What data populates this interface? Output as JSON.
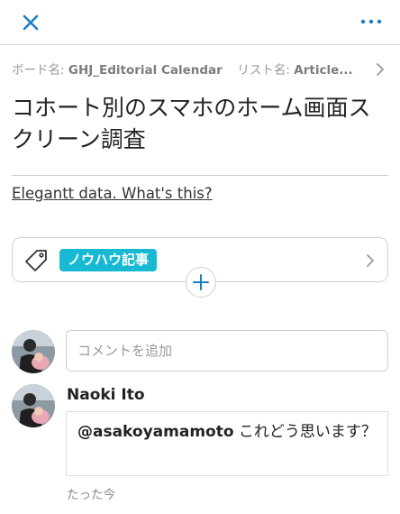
{
  "header": {
    "close_icon": "close-icon",
    "more_icon": "more-horizontal-icon",
    "accent_color": "#1a7fc2"
  },
  "breadcrumb": {
    "board_label": "ボード名:",
    "board_value": "GHJ_Editorial Calendar",
    "list_label": "リスト名:",
    "list_value": "Article..."
  },
  "card": {
    "title": "コホート別のスマホのホーム画面スクリーン調査",
    "link_text": "Elegantt data. What's this?"
  },
  "labels": {
    "items": [
      "ノウハウ記事"
    ],
    "chip_color": "#17b9d3"
  },
  "comments": {
    "input_placeholder": "コメントを追加",
    "items": [
      {
        "author": "Naoki Ito",
        "mention": "@asakoyamamoto",
        "text": " これどう思います？",
        "time": "たった今"
      }
    ]
  }
}
